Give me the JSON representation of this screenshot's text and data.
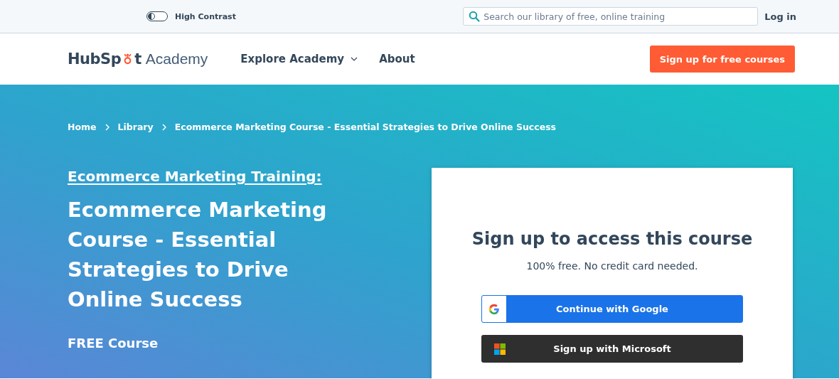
{
  "utility_bar": {
    "high_contrast": {
      "label": "High Contrast",
      "on": false
    },
    "search": {
      "placeholder": "Search our library of free, online training"
    },
    "login": "Log in"
  },
  "nav": {
    "logo": {
      "brand_start": "HubSp",
      "brand_end": "t",
      "product": "Academy"
    },
    "items": [
      {
        "label": "Explore Academy",
        "kind": "dropdown"
      },
      {
        "label": "About",
        "kind": "link"
      }
    ],
    "cta": "Sign up for free courses"
  },
  "breadcrumbs": [
    "Home",
    "Library",
    "Ecommerce Marketing Course - Essential Strategies to Drive Online Success"
  ],
  "hero": {
    "eyebrow": "Ecommerce Marketing Training:",
    "title": "Ecommerce Marketing Course - Essential Strategies to Drive Online Success",
    "price": "FREE Course"
  },
  "signup_card": {
    "title": "Sign up to access this course",
    "subtitle": "100% free. No credit card needed.",
    "buttons": [
      {
        "label": "Continue with Google",
        "kind": "google"
      },
      {
        "label": "Sign up with Microsoft",
        "kind": "microsoft"
      }
    ]
  }
}
